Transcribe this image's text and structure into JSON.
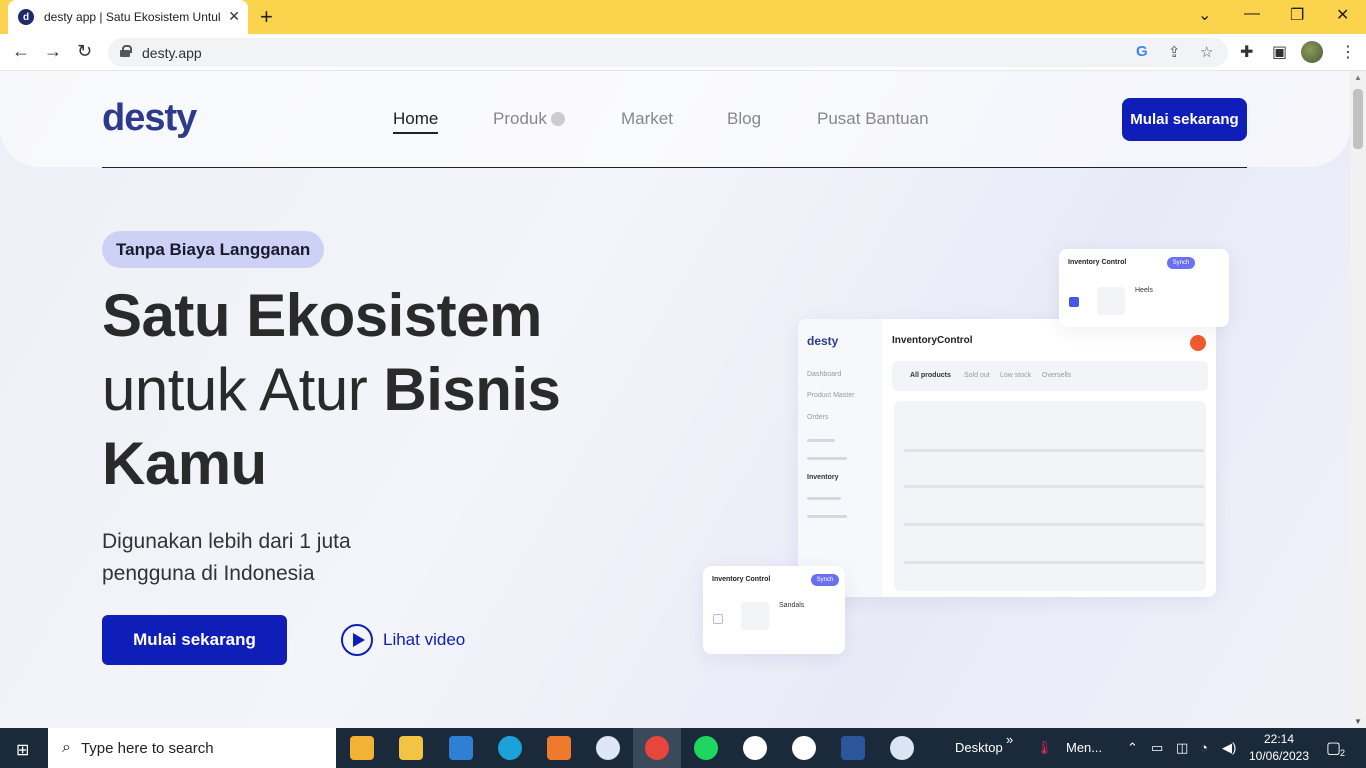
{
  "browser": {
    "tab_title": "desty app | Satu Ekosistem Untuk",
    "tab_favicon": "d",
    "url": "desty.app",
    "colors": {
      "tabbar": "#fcd34d"
    }
  },
  "site": {
    "logo": "desty",
    "nav": [
      "Home",
      "Produk",
      "Market",
      "Blog",
      "Pusat Bantuan"
    ],
    "cta_top": "Mulai sekarang",
    "colors": {
      "brand": "#0f1eb8",
      "badge_bg": "#cdd1f5"
    }
  },
  "hero": {
    "badge": "Tanpa Biaya Langganan",
    "line1": "Satu Ekosistem",
    "line2_light": "untuk Atur",
    "line2_bold": "Bisnis",
    "line3": "Kamu",
    "sub_line1": "Digunakan lebih dari 1 juta",
    "sub_line2": "pengguna di Indonesia",
    "cta": "Mulai sekarang",
    "video": "Lihat video"
  },
  "mockup": {
    "main_logo": "desty",
    "main_title": "InventoryControl",
    "side_items": [
      "Dashboard",
      "Product Master",
      "Orders",
      "Inventory"
    ],
    "tabs": [
      "All products",
      "Sold out",
      "Low stock",
      "Oversells"
    ],
    "card_top": {
      "title": "Inventory Control",
      "synch": "Synch",
      "item": "Heels"
    },
    "card_bottom": {
      "title": "Inventory Control",
      "synch": "Synch",
      "item": "Sandals"
    }
  },
  "taskbar": {
    "search_placeholder": "Type here to search",
    "desktop_label": "Desktop",
    "weather_label": "Men...",
    "time": "22:14",
    "date": "10/06/2023",
    "notif_count": "2",
    "icons": [
      "start-icon",
      "store-icon",
      "explorer-icon",
      "mail-icon",
      "edge-icon",
      "app-icon",
      "vpn-icon",
      "chrome-icon",
      "spotify-icon",
      "obs-icon",
      "whatsapp-icon",
      "word-icon",
      "paint-icon"
    ]
  }
}
